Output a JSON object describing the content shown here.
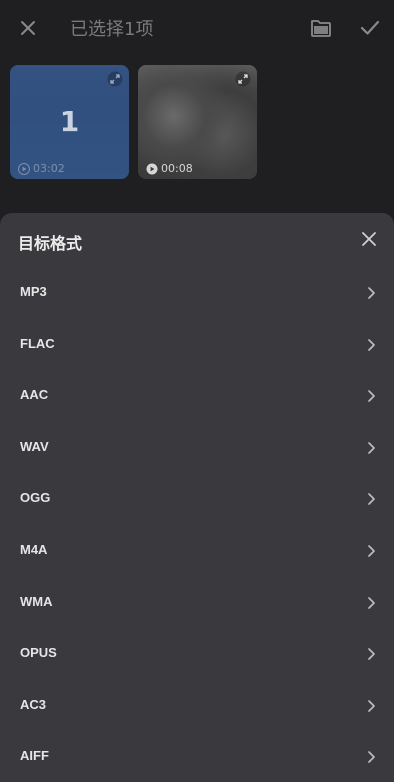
{
  "header": {
    "title": "已选择1项"
  },
  "media": [
    {
      "selection_number": "1",
      "duration": "03:02"
    },
    {
      "duration": "00:08"
    }
  ],
  "sheet": {
    "title": "目标格式",
    "formats": [
      "MP3",
      "FLAC",
      "AAC",
      "WAV",
      "OGG",
      "M4A",
      "WMA",
      "OPUS",
      "AC3",
      "AIFF"
    ]
  },
  "icons": {
    "close": "close-icon",
    "folder": "folder-icon",
    "check": "check-icon",
    "play": "play-icon",
    "expand": "expand-icon",
    "chevron": "chevron-right-icon"
  },
  "colors": {
    "background": "#1f1f21",
    "sheet": "#3a393d",
    "title_text": "#7a7a7c",
    "selection_overlay": "#2d508c"
  }
}
